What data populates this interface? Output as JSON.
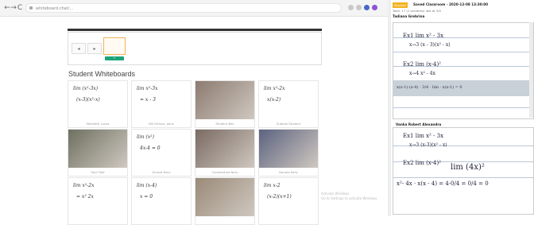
{
  "browser": {
    "back": "←",
    "forward": "→",
    "reload": "C",
    "url": "whiteboard.chat/...",
    "ext_colors": [
      "#c9c9c9",
      "#c9c9c9",
      "#4a66c9",
      "#8a56d4"
    ]
  },
  "toolbar": {
    "undo_label": "◂",
    "redo_label": "▸",
    "add_button_label": "+"
  },
  "section": {
    "title": "Student Whiteboards"
  },
  "students": [
    {
      "name": "Meredith Lucas",
      "kind": "math",
      "line1": "lim (x²-3x)",
      "line2": "(x-3)(x²-x)"
    },
    {
      "name": "Bill Felluca, Joins",
      "kind": "math",
      "line1": "lim x²-3x",
      "line2": "= x - 3"
    },
    {
      "name": "Student Bkn",
      "kind": "photo",
      "bg": "#8c7b70"
    },
    {
      "name": "Zubalia Student",
      "kind": "math",
      "line1": "lim x²-2x",
      "line2": "x(x-2)"
    },
    {
      "name": "Saul Tate",
      "kind": "photo",
      "bg": "#6e7060"
    },
    {
      "name": "Gerard Nary",
      "kind": "math",
      "line1": "lim (x²)",
      "line2": "4x-4 = 0"
    },
    {
      "name": "Constantine Nerv",
      "kind": "photo",
      "bg": "#7a6a62"
    },
    {
      "name": "Donald Keily",
      "kind": "photo",
      "bg": "#5c6380"
    },
    {
      "name": "",
      "kind": "math",
      "line1": "lim x²-2x",
      "line2": "= x² 2x"
    },
    {
      "name": "",
      "kind": "math",
      "line1": "lim (x-4)",
      "line2": "x = 0"
    },
    {
      "name": "",
      "kind": "photo",
      "bg": "#9a8a78"
    },
    {
      "name": "",
      "kind": "math",
      "line1": "lim x-2",
      "line2": "(x-2)(x+1)"
    }
  ],
  "watermark": {
    "line1": "Activate Windows",
    "line2": "Go to Settings to activate Windows."
  },
  "right_panel": {
    "tag": "Student",
    "title": "Saved Classroom - 2020-12-08 13:30:00",
    "subtitle": "Total: 17 (2 students) last at 3/0",
    "student1": "Tadiana Grebrina",
    "student2": "Vanka Robert Alexandru",
    "math_a1": "Ex1  lim  x² - 3x",
    "math_a2": "x→3 (x - 3)(x² - x)",
    "math_b1": "Ex2  lim  (x-4)²",
    "math_b2": "x→4  x² - 4x",
    "strip_text": "x(x-1)·(x-4) · 3/4 · lim · x(x-1) = 0",
    "math_c1": "Ex1  lim  x² - 3x",
    "math_c2": "x→3 (x-3)(x² - x)",
    "math_d1": "Ex2  lim  (x-4)²",
    "math_d2": "x²- 4x · x(x - 4)  =  4·0/4 = 0/4 = 0",
    "math_d3": "lim (4x)²"
  }
}
